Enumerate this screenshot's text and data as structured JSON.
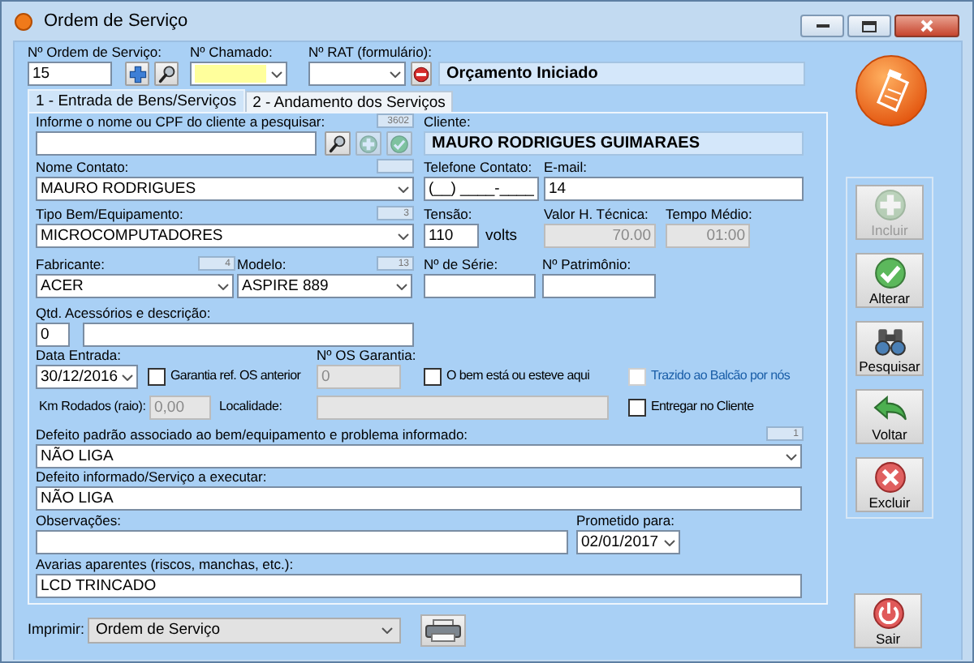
{
  "window": {
    "title": "Ordem de Serviço"
  },
  "header": [
    {
      "kind": "text",
      "label": "Nº Ordem de Serviço:",
      "value": "15"
    },
    {
      "kind": "plus"
    },
    {
      "kind": "search"
    },
    {
      "kind": "combo",
      "label": "Nº Chamado:",
      "focused": true
    },
    {
      "kind": "combo",
      "label": "Nº RAT (formulário):"
    },
    {
      "kind": "stop"
    },
    {
      "kind": "display",
      "value": "Orçamento Iniciado"
    }
  ],
  "tabs": [
    {
      "label": "1 - Entrada de Bens/Serviços",
      "selected": true
    },
    {
      "label": "2 - Andamento dos Serviços",
      "selected": false
    }
  ],
  "form": [
    [
      {
        "kind": "text",
        "label": "Informe o nome ou CPF do cliente a pesquisar:",
        "counter": "3602"
      },
      {
        "kind": "search"
      },
      {
        "kind": "add",
        "disabled": true
      },
      {
        "kind": "confirm",
        "disabled": true
      },
      {
        "kind": "display",
        "label": "Cliente:",
        "value": "MAURO RODRIGUES GUIMARAES"
      }
    ],
    [
      {
        "kind": "combo",
        "label": "Nome Contato:",
        "value": "MAURO RODRIGUES",
        "empty_counter": true
      },
      {
        "kind": "text",
        "label": "Telefone Contato:",
        "value": "(__) ____-____"
      },
      {
        "kind": "text",
        "label": "E-mail:",
        "value": "14"
      }
    ],
    [
      {
        "kind": "combo",
        "label": "Tipo Bem/Equipamento:",
        "value": "MICROCOMPUTADORES",
        "counter": "3"
      },
      {
        "kind": "text",
        "label": "Tensão:",
        "value": "110"
      },
      {
        "kind": "unit",
        "value": "volts"
      },
      {
        "kind": "text",
        "label": "Valor H. Técnica:",
        "value": "70.00",
        "readonly": true
      },
      {
        "kind": "text",
        "label": "Tempo Médio:",
        "value": "01:00",
        "readonly": true
      }
    ],
    [
      {
        "kind": "combo",
        "label": "Fabricante:",
        "value": "ACER",
        "counter": "4"
      },
      {
        "kind": "combo",
        "label": "Modelo:",
        "value": "ASPIRE 889",
        "counter": "13"
      },
      {
        "kind": "text",
        "label": "Nº de Série:"
      },
      {
        "kind": "text",
        "label": "Nº Patrimônio:"
      }
    ],
    [
      {
        "kind": "text",
        "label": "Qtd. Acessórios e descrição:",
        "value": "0"
      },
      {
        "kind": "text"
      }
    ],
    [
      {
        "kind": "combo",
        "label": "Data Entrada:",
        "value": "30/12/2016"
      },
      {
        "kind": "check",
        "label": "Garantia ref. OS anterior",
        "checked": false
      },
      {
        "kind": "text",
        "label": "Nº OS Garantia:",
        "value": "0",
        "readonly": true
      },
      {
        "kind": "check",
        "label": "O bem está ou esteve aqui",
        "checked": false
      },
      {
        "kind": "check",
        "label": "Trazido ao Balcão por nós",
        "checked": false,
        "disabled": true
      }
    ],
    [
      {
        "kind": "text",
        "label": "Km Rodados (raio):",
        "value": "0,00",
        "readonly": true
      },
      {
        "kind": "text",
        "label": "Localidade:",
        "readonly": true
      },
      {
        "kind": "check",
        "label": "Entregar no Cliente",
        "checked": false
      }
    ],
    [
      {
        "kind": "combo",
        "label": "Defeito padrão associado ao bem/equipamento e problema informado:",
        "value": "NÃO LIGA",
        "counter": "1"
      }
    ],
    [
      {
        "kind": "text",
        "label": "Defeito informado/Serviço a executar:",
        "value": "NÃO LIGA"
      }
    ],
    [
      {
        "kind": "text",
        "label": "Observações:"
      },
      {
        "kind": "combo",
        "label": "Prometido para:",
        "value": "02/01/2017"
      }
    ],
    [
      {
        "kind": "text",
        "label": "Avarias aparentes (riscos, manchas, etc.):",
        "value": "LCD TRINCADO"
      }
    ]
  ],
  "actions": [
    {
      "kind": "add",
      "label": "Incluir",
      "disabled": true
    },
    {
      "kind": "confirm",
      "label": "Alterar",
      "disabled": false
    },
    {
      "kind": "binoculars",
      "label": "Pesquisar",
      "disabled": false
    },
    {
      "kind": "back",
      "label": "Voltar",
      "disabled": false
    },
    {
      "kind": "delete",
      "label": "Excluir",
      "disabled": false
    }
  ],
  "exit": {
    "kind": "power",
    "label": "Sair"
  },
  "print": {
    "label": "Imprimir:",
    "value": "Ordem de Serviço"
  }
}
